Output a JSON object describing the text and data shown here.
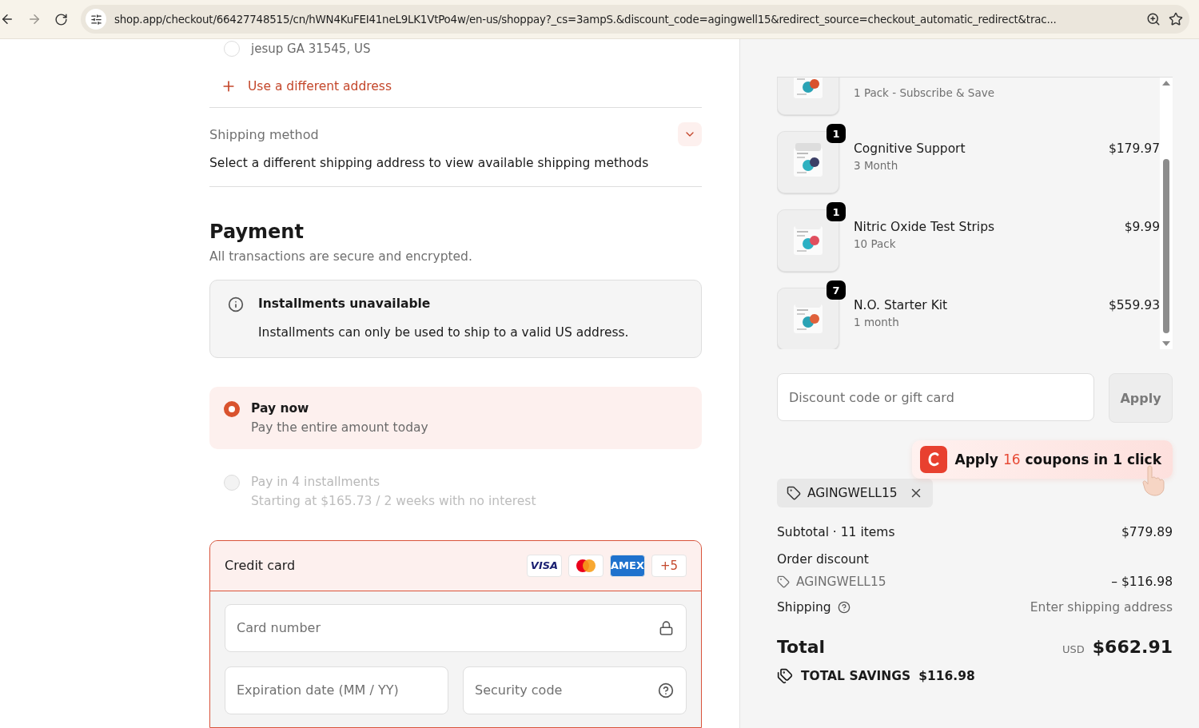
{
  "browser": {
    "url": "shop.app/checkout/66427748515/cn/hWN4KuFEI41neL9LK1VtPo4w/en-us/shoppay?_cs=3ampS.&discount_code=agingwell15&redirect_source=checkout_automatic_redirect&trac..."
  },
  "address": {
    "line": "jesup GA 31545, US",
    "selected": false
  },
  "use_different_address": "Use a different address",
  "shipping_method": {
    "title": "Shipping method",
    "message": "Select a different shipping address to view available shipping methods",
    "expanded": false
  },
  "payment": {
    "title": "Payment",
    "subtitle": "All transactions are secure and encrypted.",
    "notice": {
      "title": "Installments unavailable",
      "text": "Installments can only be used to ship to a valid US address."
    },
    "options": [
      {
        "label": "Pay now",
        "description": "Pay the entire amount today",
        "selected": true,
        "disabled": false
      },
      {
        "label": "Pay in 4 installments",
        "description": "Starting at $165.73 / 2 weeks with no interest",
        "selected": false,
        "disabled": true
      }
    ],
    "credit_card": {
      "label": "Credit card",
      "selected": true,
      "brands": [
        {
          "kind": "visa",
          "label": "VISA"
        },
        {
          "kind": "mastercard"
        },
        {
          "kind": "amex",
          "label": "AMEX"
        },
        {
          "kind": "more",
          "label": "+5"
        }
      ],
      "fields": [
        {
          "kind": "lock",
          "placeholder": "Card number"
        },
        {
          "kind": "plain",
          "placeholder": "Expiration date (MM / YY)"
        },
        {
          "kind": "help",
          "placeholder": "Security code"
        }
      ]
    }
  },
  "order": {
    "items": [
      {
        "variant": "1 Pack - Subscribe & Save"
      },
      {
        "quantity": "1",
        "name": "Cognitive Support",
        "variant": "3 Month",
        "price": "$179.97"
      },
      {
        "quantity": "1",
        "name": "Nitric Oxide Test Strips",
        "variant": "10 Pack",
        "price": "$9.99"
      },
      {
        "quantity": "7",
        "name": "N.O. Starter Kit",
        "variant": "1 month",
        "price": "$559.93"
      }
    ],
    "discount": {
      "placeholder": "Discount code or gift card",
      "button": "Apply"
    },
    "coupon_prompt": {
      "before": "Apply",
      "count": "16",
      "after": "coupons in 1 click"
    },
    "applied_code": "AGINGWELL15",
    "subtotal": {
      "label": "Subtotal · 11 items",
      "value": "$779.89"
    },
    "order_discount": {
      "label": "Order discount",
      "code": "AGINGWELL15",
      "value": "– $116.98"
    },
    "shipping": {
      "label": "Shipping",
      "value": "Enter shipping address"
    },
    "total": {
      "label": "Total",
      "currency": "USD",
      "value": "$662.91"
    },
    "savings": {
      "label": "TOTAL SAVINGS",
      "value": "$116.98"
    }
  }
}
